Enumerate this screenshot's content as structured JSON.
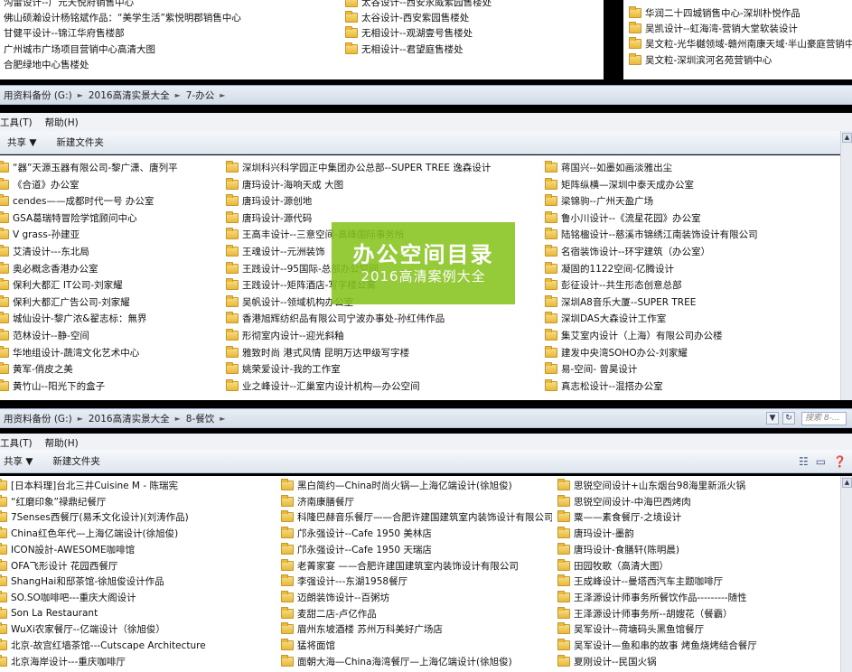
{
  "panel1": {
    "col1": [
      "沟雷设计--广元天悦府销售中心",
      "佛山硕瀚设计杨铭斌作品：“美学生活”紫悦明郡销售中心",
      "甘健平设计--锦江华府售楼部",
      "广州城市广场项目营销中心高清大图",
      "合肥绿地中心售楼处"
    ],
    "col2": [
      "太谷设计--西安永威紫园售楼处",
      "太谷设计-西安紫园售楼处",
      "无相设计--观湖壹号售楼处",
      "无相设计--君望庭售楼处"
    ],
    "col3": [
      "华润二十四城销售中心-深圳朴悦作品",
      "吴凯设计--虹海湾-营销大堂软装设计",
      "吴文粒-光华樾领域-赣州南康天域·半山豪庭营销中心",
      "吴文粒-深圳滨河名苑营销中心"
    ]
  },
  "panel2": {
    "breadcrumb": [
      "用资料备份 (G:)",
      "2016高清实景大全",
      "7-办公"
    ],
    "menu": [
      "工具(T)",
      "帮助(H)"
    ],
    "toolbar": {
      "share": "共享 ▼",
      "new_folder": "新建文件夹"
    },
    "col1": [
      "“器”天源玉器有限公司-黎广潇、唐列平",
      "《合道》办公室",
      "cendes——成都时代一号 办公室",
      "GSA葛瑞特冒险学馆顾问中心",
      "V grass-孙建亚",
      "艾清设计---东北局",
      "奥必概念香港办公室",
      "保利大都汇 IT公司-刘家耀",
      "保利大都汇广告公司-刘家耀",
      "城仙设计-黎广浓&翟志标：無界",
      "范林设计--静-空间",
      "华地组设计-蔬湾文化艺术中心",
      "黄军-俏皮之美",
      "黄竹山--阳光下的盒子"
    ],
    "col2": [
      "深圳科兴科学园正中集团办公总部--SUPER TREE 逸森设计",
      "唐玛设计-海响天成 大图",
      "唐玛设计-源创地",
      "唐玛设计-源代码",
      "王高丰设计--三意空间-高峰国际事务所",
      "王魂设计--元洲装饰",
      "王践设计--95国际-总部办公空间",
      "王践设计--矩阵酒店-写字楼公寓",
      "吴帆设计--领域机构办公室",
      "香港旭辉纺织品有限公司宁波办事处-孙红伟作品",
      "形彻室内设计--迎光斜釉",
      "雅致时尚 港式风情 昆明万达甲级写字楼",
      "姚荣爱设计-我的工作室",
      "业之峰设计--汇巢室内设计机构—办公空间"
    ],
    "col3": [
      "蒋国兴--如墨如画淡雅出尘",
      "矩阵纵横—深圳中泰天成办公室",
      "梁锦驹--广州天盈广场",
      "鲁小川设计--《流星花园》办公室",
      "陆铭楹设计--慈溪市锦绣江南装饰设计有限公司",
      "名宿装饰设计--环宇建筑（办公室）",
      "凝固的1122空间-亿腾设计",
      "彭征设计--共生形态创意总部",
      "深圳A8音乐大厦--SUPER TREE",
      "深圳DAS大森设计工作室",
      "集艾室内设计（上海）有限公司办公楼",
      "建发中央湾SOHO办公-刘家耀",
      "易-空间- 曾昊设计",
      "真志松设计--混搭办公室"
    ],
    "overlay": {
      "title": "办公空间目录",
      "subtitle": "2016高清案例大全"
    }
  },
  "panel3": {
    "breadcrumb": [
      "用资料备份 (G:)",
      "2016高清实景大全",
      "8-餐饮"
    ],
    "search_placeholder": "搜索 8-...",
    "menu": [
      "工具(T)",
      "帮助(H)"
    ],
    "toolbar": {
      "share": "共享 ▼",
      "new_folder": "新建文件夹"
    },
    "col1": [
      "[日本料理]台北三井Cuisine M - 陈瑞宪",
      "“红磨印象”禄鼎纪餐厅",
      "7Senses西餐厅(易禾文化设计)(刘涛作品)",
      "China红色年代—上海亿端设计(徐旭俊)",
      "ICON設計-AWESOME咖啡馆",
      "OFA飞形设计 花园西餐厅",
      "ShangHai和邸茶馆-徐旭俊设计作品",
      "SO.SO咖啡吧---重庆大阁设计",
      "Son La Restaurant",
      "WuXi农家餐厅--亿端设计（徐旭俊）",
      "北京-故宫红墙茶馆---Cutscape Architecture",
      "北京海岸设计---重庆咖啡厅"
    ],
    "col2": [
      "黑白简约—China时尚火锅—上海亿端设计(徐旭俊)",
      "济南康膳餐厅",
      "科隆巴赫音乐餐厅——合肥许建国建筑室内装饰设计有限公司",
      "邝永强设计--Cafe 1950 美林店",
      "邝永强设计--Cafe 1950 天瑞店",
      "老菁家宴 ——合肥许建国建筑室内装饰设计有限公司",
      "李强设计---东湖1958餐厅",
      "迈朗装饰设计--百粥坊",
      "麦甜二店-卢亿作品",
      "眉州东坡酒楼 苏州万科美好广场店",
      "猛将面馆",
      "面朝大海—China海湾餐厅—上海亿端设计(徐旭俊)"
    ],
    "col3": [
      "思锐空间设计+山东烟台98海里新派火锅",
      "思锐空间设计-中海巴西烤肉",
      "粟——素食餐厅-之境设计",
      "唐玛设计-墨韵",
      "唐玛设计-食膳轩(陈明晨)",
      "田园牧歌（高清大图）",
      "王成峰设计--曼塔西汽车主题咖啡厅",
      "王泽源设计师事务所餐饮作品---------随性",
      "王泽源设计师事务所--胡嫂花（餐霸）",
      "吴军设计--荷塘码头黑鱼馆餐厅",
      "吴军设计—鱼和串的故事 烤鱼烧烤结合餐厅",
      "夏刚设计--民国火锅"
    ]
  }
}
